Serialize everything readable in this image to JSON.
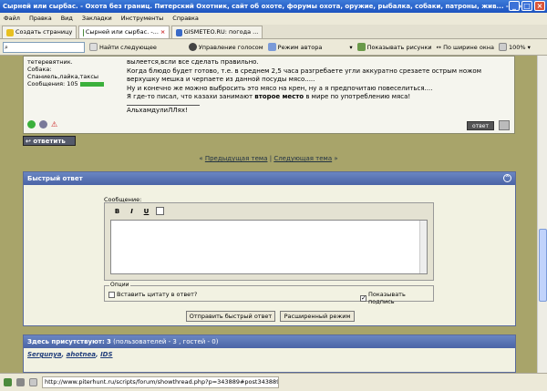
{
  "window": {
    "title": "Сырней или сырбас. - Охота без границ. Питерский Охотник, сайт об охоте, форумы охота, оружие, рыбалка, собаки, патроны, жив... - Opera",
    "minimize": "_",
    "maximize": "□",
    "close": "×"
  },
  "menu": [
    "Файл",
    "Правка",
    "Вид",
    "Закладки",
    "Инструменты",
    "Справка"
  ],
  "tabs": [
    {
      "label": "Создать страницу"
    },
    {
      "label": "Сырней или сырбас. -..."
    },
    {
      "label": "GISMETEO.RU: погода ..."
    }
  ],
  "toolbar": {
    "find_next": "Найти следующее",
    "voice": "Управление голосом",
    "author_mode": "Режим автора",
    "show_images": "Показывать рисунки",
    "fit_width": "По ширине окна",
    "zoom": "100%"
  },
  "post": {
    "user_lines": [
      "тетеревятник.",
      "Собака:",
      "Спаниель,лайка,таксы"
    ],
    "messages_label": "Сообщения: 105",
    "text_lines": [
      "вылеется,всли все сделать правильно.",
      "Когда блюдо будет готово, т.е. в среднем 2,5 часа разгребаете угли аккуратно срезаете острым ножом",
      "верхушку мешка и черпаете из данной посуды мясо.....",
      "Ну и конечно же можно выбросить это мясо на крен, ну а я предпочитаю повеселиться....",
      "Я где-то писал, что казахи занимают"
    ],
    "bold_phrase": "второе место",
    "text_tail": " в мире по употреблению мяса!",
    "signature": "АльхамдулиЛЛях!",
    "reply_small": "ответ"
  },
  "reply_button": "ответить",
  "nav": {
    "prev": "Предыдущая тема",
    "separator": "|",
    "next": "Следующая тема",
    "left_arrows": "«",
    "right_arrows": "»"
  },
  "quick_reply": {
    "title": "Быстрый ответ",
    "message_label": "Сообщение:",
    "bold": "B",
    "italic": "I",
    "underline": "U",
    "options_legend": "Опции",
    "quote_option": "Вставить цитату в ответ?",
    "signature_option": "Показывать подпись",
    "send_button": "Отправить быстрый ответ",
    "advanced_button": "Расширенный режим"
  },
  "present": {
    "label": "Здесь присутствуют:",
    "count": "3",
    "detail": "(пользователей - 3 , гостей - 0)",
    "users": [
      "Sergunya",
      "ahotnea",
      "IDS"
    ]
  },
  "status": {
    "url": "http://www.piterhunt.ru/scripts/forum/showthread.php?p=343889#post343889"
  },
  "colors": {
    "page_background": "#a8a46a",
    "header_blue": "#4a64a6",
    "titlebar_blue": "#1d53bf"
  }
}
